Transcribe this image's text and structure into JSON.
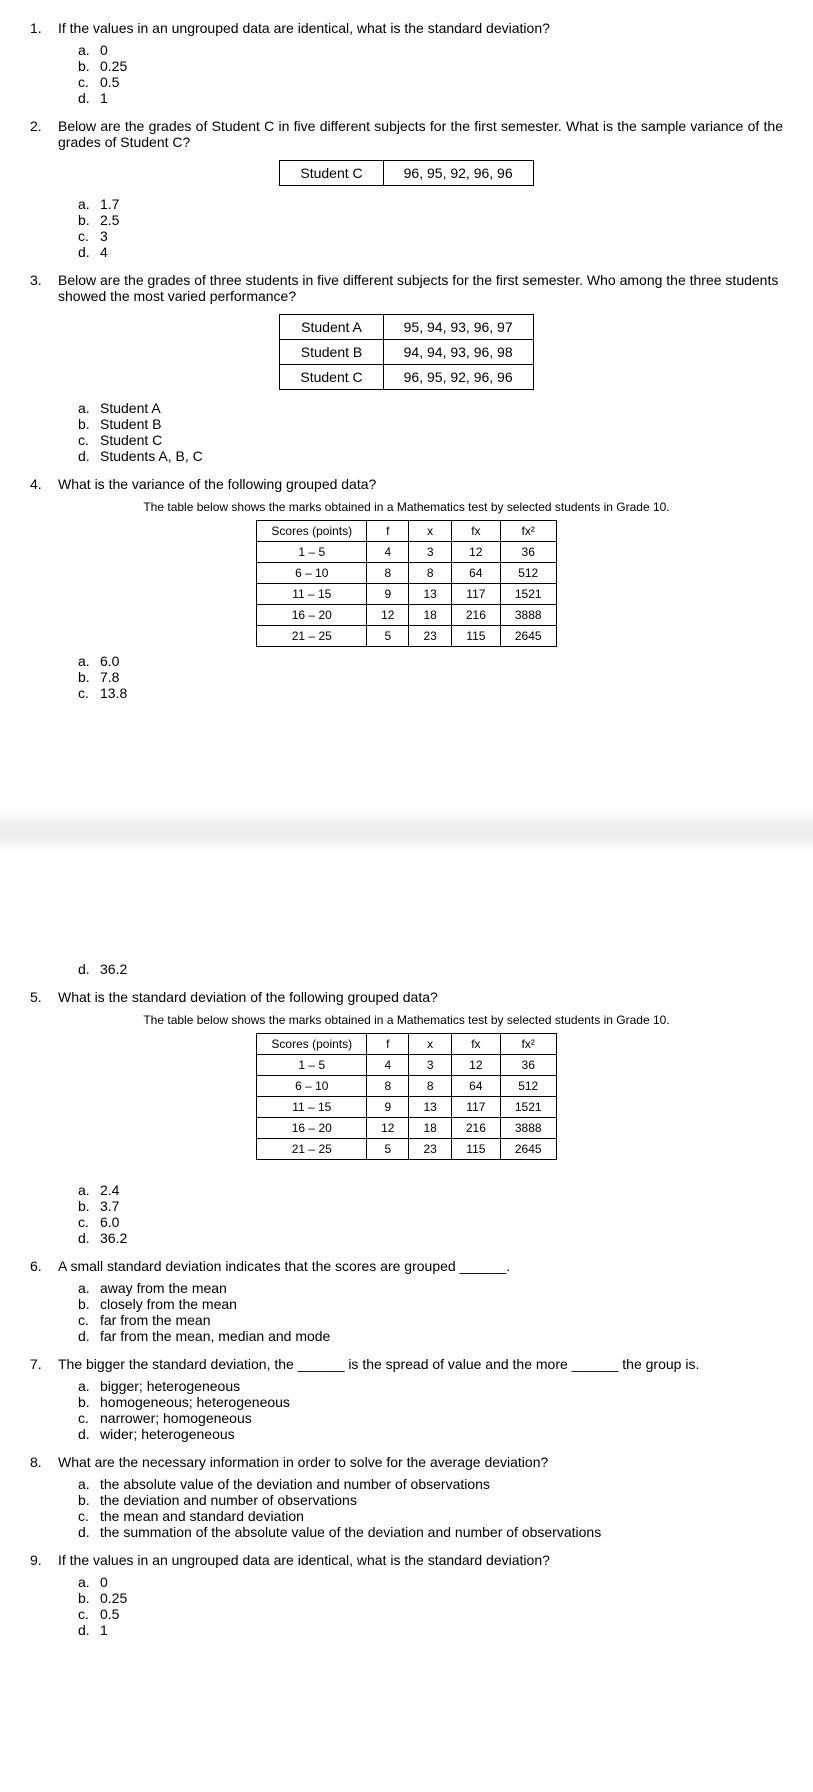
{
  "q1": {
    "n": "1.",
    "t": "If the values in an ungrouped data are identical, what is the standard deviation?",
    "a": "0",
    "b": "0.25",
    "c": "0.5",
    "d": "1"
  },
  "q2": {
    "n": "2.",
    "t": "Below are the grades of Student C in five different subjects for the first semester. What is the sample variance of the grades of Student C?",
    "hdr": "Student C",
    "vals": "96, 95, 92, 96, 96",
    "a": "1.7",
    "b": "2.5",
    "c": "3",
    "d": "4"
  },
  "q3": {
    "n": "3.",
    "t": "Below are the grades of three students in five different subjects for the first semester. Who among the three students showed the most varied performance?",
    "r1a": "Student A",
    "r1b": "95, 94, 93, 96, 97",
    "r2a": "Student B",
    "r2b": "94, 94, 93, 96, 98",
    "r3a": "Student C",
    "r3b": "96, 95, 92, 96, 96",
    "a": "Student A",
    "b": "Student B",
    "c": "Student C",
    "d": "Students A, B, C"
  },
  "q4": {
    "n": "4.",
    "t": "What is the variance of the following grouped data?",
    "cap": "The table below shows the marks obtained in a Mathematics test by selected students in Grade 10.",
    "a": "6.0",
    "b": "7.8",
    "c": "13.8",
    "d": "36.2"
  },
  "tbl": {
    "h1": "Scores (points)",
    "h2": "f",
    "h3": "x",
    "h4": "fx",
    "h5": "fx²",
    "r1": [
      "1 – 5",
      "4",
      "3",
      "12",
      "36"
    ],
    "r2": [
      "6 – 10",
      "8",
      "8",
      "64",
      "512"
    ],
    "r3": [
      "11 – 15",
      "9",
      "13",
      "117",
      "1521"
    ],
    "r4": [
      "16 – 20",
      "12",
      "18",
      "216",
      "3888"
    ],
    "r5": [
      "21 – 25",
      "5",
      "23",
      "115",
      "2645"
    ]
  },
  "q5": {
    "n": "5.",
    "t": "What is the standard deviation of the following grouped data?",
    "a": "2.4",
    "b": "3.7",
    "c": "6.0",
    "d": "36.2"
  },
  "q6": {
    "n": "6.",
    "t": "A small standard deviation indicates that the scores are grouped ______.",
    "a": "away from the mean",
    "b": "closely from the mean",
    "c": "far from the mean",
    "d": "far from the mean, median and mode"
  },
  "q7": {
    "n": "7.",
    "t": "The bigger the standard deviation, the ______ is the spread of value and the more ______ the group is.",
    "a": "bigger; heterogeneous",
    "b": "homogeneous; heterogeneous",
    "c": "narrower; homogeneous",
    "d": "wider; heterogeneous"
  },
  "q8": {
    "n": "8.",
    "t": "What are the necessary information in order to solve for the average deviation?",
    "a": "the absolute value of the deviation and number of observations",
    "b": "the deviation and number of observations",
    "c": "the mean and standard deviation",
    "d": "the summation of the absolute value of the deviation and number of observations"
  },
  "q9": {
    "n": "9.",
    "t": "If the values in an ungrouped data are identical, what is the standard deviation?",
    "a": "0",
    "b": "0.25",
    "c": "0.5",
    "d": "1"
  },
  "L": {
    "a": "a.",
    "b": "b.",
    "c": "c.",
    "d": "d."
  }
}
